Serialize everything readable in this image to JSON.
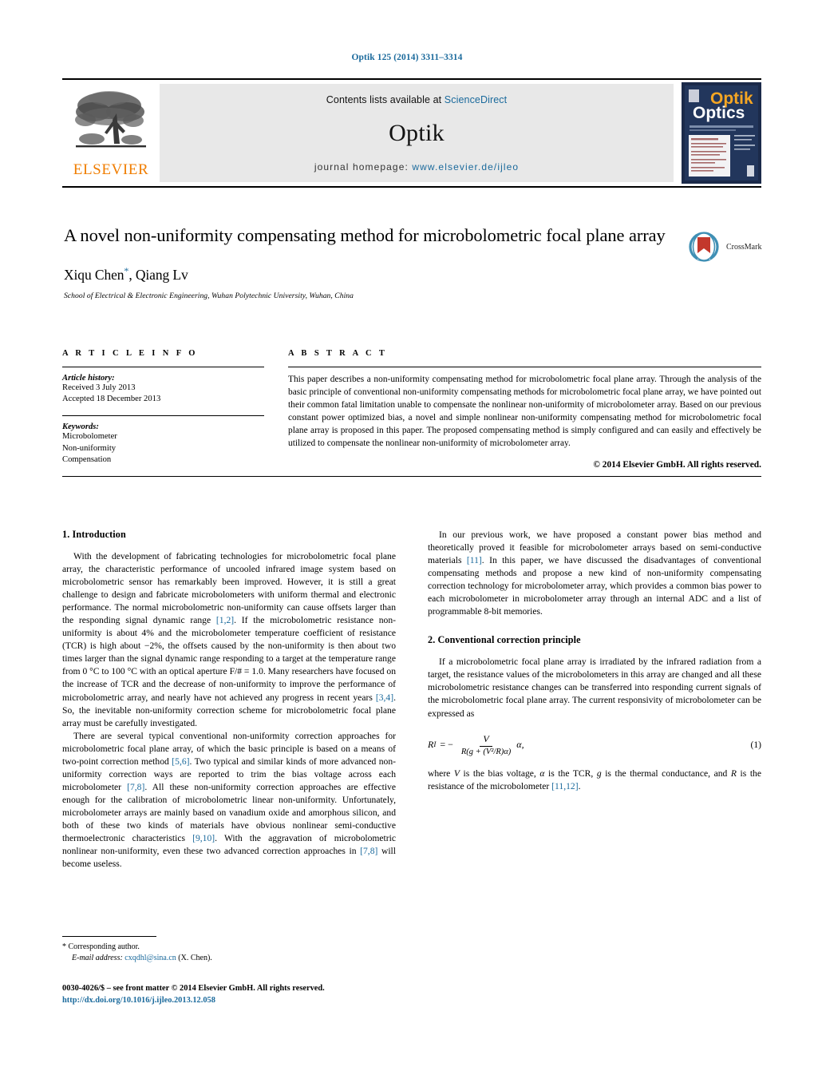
{
  "running_head": "Optik 125 (2014) 3311–3314",
  "masthead": {
    "publisher_name": "ELSEVIER",
    "contents_prefix": "Contents lists available at ",
    "contents_link": "ScienceDirect",
    "journal_title": "Optik",
    "homepage_prefix": "journal  homepage:  ",
    "homepage_url": "www.elsevier.de/ijleo",
    "cover": {
      "title_top": "Optik",
      "title_bottom": "Optics"
    }
  },
  "article": {
    "title": "A novel non-uniformity compensating method for microbolometric focal plane array",
    "authors": "Xiqu Chen",
    "author_marker": "*",
    "authors_rest": ", Qiang Lv",
    "affiliation": "School of Electrical & Electronic Engineering, Wuhan Polytechnic University, Wuhan, China",
    "crossmark_label": "CrossMark"
  },
  "info": {
    "heading": "A R T I C L E   I N F O",
    "history_label": "Article history:",
    "received": "Received 3 July 2013",
    "accepted": "Accepted 18 December 2013",
    "keywords_label": "Keywords:",
    "keywords": [
      "Microbolometer",
      "Non-uniformity",
      "Compensation"
    ]
  },
  "abstract": {
    "heading": "A B S T R A C T",
    "text": "This paper describes a non-uniformity compensating method for microbolometric focal plane array. Through the analysis of the basic principle of conventional non-uniformity compensating methods for microbolometric focal plane array, we have pointed out their common fatal limitation unable to compensate the nonlinear non-uniformity of microbolometer array. Based on our previous constant power optimized bias, a novel and simple nonlinear non-uniformity compensating method for microbolometric focal plane array is proposed in this paper. The proposed compensating method is simply configured and can easily and effectively be utilized to compensate the nonlinear non-uniformity of microbolometer array.",
    "copyright": "© 2014 Elsevier GmbH. All rights reserved."
  },
  "body": {
    "section1_heading": "1.  Introduction",
    "para1_a": "With the development of fabricating technologies for microbolometric focal plane array, the characteristic performance of uncooled infrared image system based on microbolometric sensor has remarkably been improved. However, it is still a great challenge to design and fabricate microbolometers with uniform thermal and electronic performance. The normal microbolometric non-uniformity can cause offsets larger than the responding signal dynamic range ",
    "para1_ref1": "[1,2]",
    "para1_b": ". If the microbolometric resistance non-uniformity is about 4% and the microbolometer temperature coefficient of resistance (TCR) is high about −2%, the offsets caused by the non-uniformity is then about two times larger than the signal dynamic range responding to a target at the temperature range from 0 °C to 100 °C with an optical aperture F/# = 1.0. Many researchers have focused on the increase of TCR and the decrease of non-uniformity to improve the performance of microbolometric array, and nearly have not achieved any progress in recent years ",
    "para1_ref2": "[3,4]",
    "para1_c": ". So, the inevitable non-uniformity correction scheme for microbolometric focal plane array must be carefully investigated.",
    "para2_a": "There are several typical conventional non-uniformity correction approaches for microbolometric focal plane array, of which the basic principle is based on a means of two-point correction method ",
    "para2_ref1": "[5,6]",
    "para2_b": ". Two typical and similar kinds of more advanced non-uniformity correction ways are reported to trim the bias voltage across each microbolometer ",
    "para2_ref2": "[7,8]",
    "para2_c": ". All these non-uniformity correction approaches are effective enough for the calibration of microbolometric linear non-uniformity. Unfortunately, microbolometer arrays are mainly based on vanadium oxide and amorphous silicon, and both of these two kinds of materials have obvious nonlinear semi-conductive thermoelectronic characteristics ",
    "para2_ref3": "[9,10]",
    "para2_d": ". With the aggravation of microbolometric nonlinear non-uniformity, even these two advanced correction approaches in ",
    "para2_ref4": "[7,8]",
    "para2_e": " will become useless.",
    "para3_a": "In our previous work, we have proposed a constant power bias method and theoretically proved it feasible for microbolometer arrays based on semi-conductive materials ",
    "para3_ref1": "[11]",
    "para3_b": ". In this paper, we have discussed the disadvantages of conventional compensating methods and propose a new kind of non-uniformity compensating correction technology for microbolometer array, which provides a common bias power to each microbolometer in microbolometer array through an internal ADC and a list of programmable 8-bit memories.",
    "section2_heading": "2.  Conventional correction principle",
    "para4": "If a microbolometric focal plane array is irradiated by the infrared radiation from a target, the resistance values of the microbolometers in this array are changed and all these microbolometric resistance changes can be transferred into responding current signals of the microbolometric focal plane array. The current responsivity of microbolometer can be expressed as",
    "equation": {
      "lhs": "R",
      "lhs_sub": "I",
      "equals": "= −",
      "numerator": "V",
      "denominator": "R(g + (V²/R)α)",
      "trailing": "α,",
      "number": "(1)"
    },
    "para5_a": "where ",
    "para5_V": "V",
    "para5_b": " is the bias voltage, ",
    "para5_alpha": "α",
    "para5_c": " is the TCR, ",
    "para5_g": "g",
    "para5_d": " is the thermal conductance, and ",
    "para5_R": "R",
    "para5_e": " is the resistance of the microbolometer ",
    "para5_ref": "[11,12]",
    "para5_f": "."
  },
  "footnote": {
    "corresponding": "*  Corresponding author.",
    "email_label": "E-mail address:",
    "email": "cxqdhl@sina.cn",
    "email_suffix": "(X. Chen)."
  },
  "frontmatter": {
    "issn_line": "0030-4026/$ – see front matter © 2014 Elsevier GmbH. All rights reserved.",
    "doi": "http://dx.doi.org/10.1016/j.ijleo.2013.12.058"
  },
  "colors": {
    "link_blue": "#1b6a9c",
    "elsevier_orange": "#f07d00",
    "cover_navy": "#1b2a4a",
    "crossmark_red": "#c3382c",
    "crossmark_blue": "#3f8fb4"
  }
}
